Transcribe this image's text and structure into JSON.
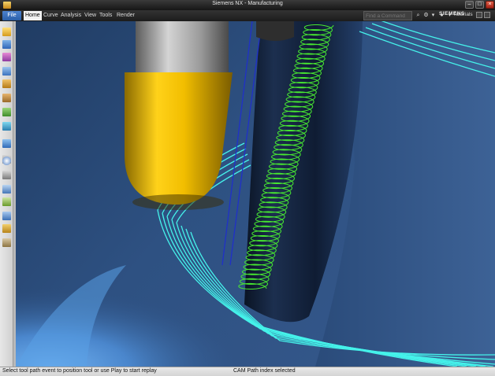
{
  "window": {
    "title": "Siemens NX - Manufacturing"
  },
  "menubar": {
    "file": "File",
    "items": [
      "Home",
      "Curve",
      "Analysis",
      "View",
      "Tools",
      "Render"
    ],
    "search_placeholder": "Find a Command",
    "brand": "SIEMENS",
    "tutorials": "Tutorials"
  },
  "statusbar": {
    "prompt": "Select tool path event to position tool or use Play to start replay",
    "message": "CAM Path index selected"
  },
  "icons": {
    "toolbar": [
      "new-icon",
      "open-icon",
      "operation-icon",
      "program-icon",
      "geometry-icon",
      "method-icon",
      "generate-icon",
      "verify-icon",
      "simulate-icon",
      "postprocess-icon",
      "shop-doc-icon",
      "clock-icon",
      "list-icon",
      "edit-icon",
      "measure-icon",
      "tool-icon",
      "settings-icon"
    ]
  },
  "colors": {
    "viewport_background": "#2c4b74",
    "toolpath": "#40f0e8",
    "helix_path": "#40e030",
    "tool_holder": "#e8b800",
    "accent": "#2a5ea8"
  }
}
